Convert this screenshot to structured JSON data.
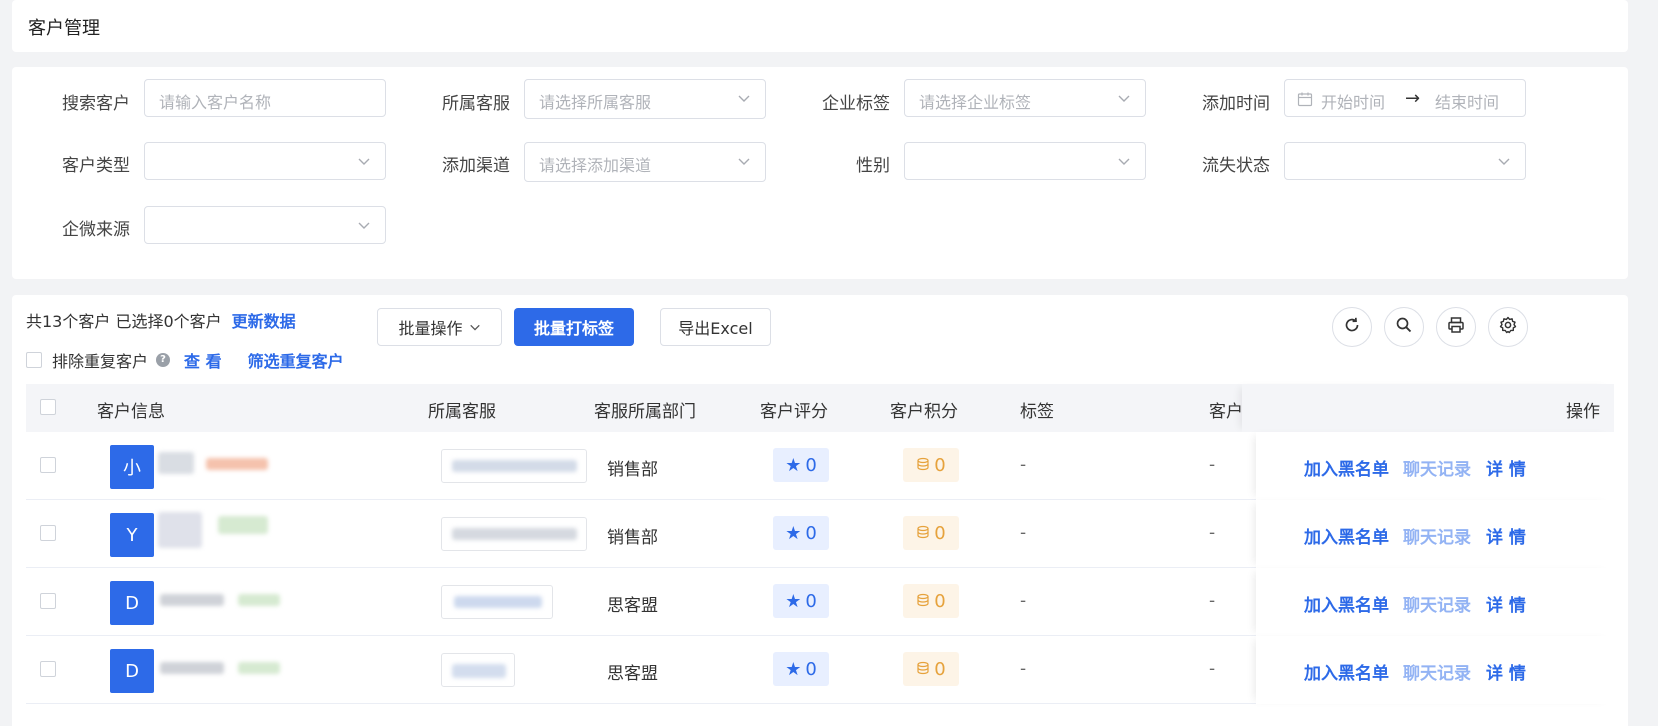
{
  "page": {
    "title": "客户管理"
  },
  "filters": {
    "search_customer": {
      "label": "搜索客户",
      "placeholder": "请输入客户名称"
    },
    "service": {
      "label": "所属客服",
      "placeholder": "请选择所属客服"
    },
    "corp_tag": {
      "label": "企业标签",
      "placeholder": "请选择企业标签"
    },
    "add_time": {
      "label": "添加时间",
      "start_placeholder": "开始时间",
      "end_placeholder": "结束时间",
      "separator": "→"
    },
    "customer_type": {
      "label": "客户类型",
      "placeholder": ""
    },
    "add_channel": {
      "label": "添加渠道",
      "placeholder": "请选择添加渠道"
    },
    "gender": {
      "label": "性别",
      "placeholder": ""
    },
    "churn_status": {
      "label": "流失状态",
      "placeholder": ""
    },
    "wecom_source": {
      "label": "企微来源",
      "placeholder": ""
    }
  },
  "toolbar": {
    "summary": "共13个客户 已选择0个客户",
    "refresh_data": "更新数据",
    "exclude_duplicates": "排除重复客户",
    "view": "查 看",
    "filter_duplicates": "筛选重复客户",
    "batch_ops": "批量操作",
    "batch_tag": "批量打标签",
    "export": "导出Excel"
  },
  "icons": [
    "refresh-icon",
    "search-icon",
    "print-icon",
    "settings-icon"
  ],
  "table": {
    "columns": {
      "info": "客户信息",
      "service": "所属客服",
      "dept": "客服所属部门",
      "score": "客户评分",
      "points": "客户积分",
      "tags": "标签",
      "more": "客户",
      "ops": "操作"
    },
    "rows": [
      {
        "avatar": "小",
        "dept": "销售部",
        "score": "0",
        "points": "0",
        "tags": "-",
        "more": "-"
      },
      {
        "avatar": "Y",
        "dept": "销售部",
        "score": "0",
        "points": "0",
        "tags": "-",
        "more": "-"
      },
      {
        "avatar": "D",
        "dept": "思客盟",
        "score": "0",
        "points": "0",
        "tags": "-",
        "more": "-"
      },
      {
        "avatar": "D",
        "dept": "思客盟",
        "score": "0",
        "points": "0",
        "tags": "-",
        "more": "-"
      }
    ],
    "actions": {
      "blacklist": "加入黑名单",
      "chat": "聊天记录",
      "detail": "详 情"
    }
  },
  "colors": {
    "primary": "#2d6ae8",
    "score_bg": "#e8efff",
    "points_color": "#e6a23c",
    "points_bg": "#fdf4e7"
  }
}
